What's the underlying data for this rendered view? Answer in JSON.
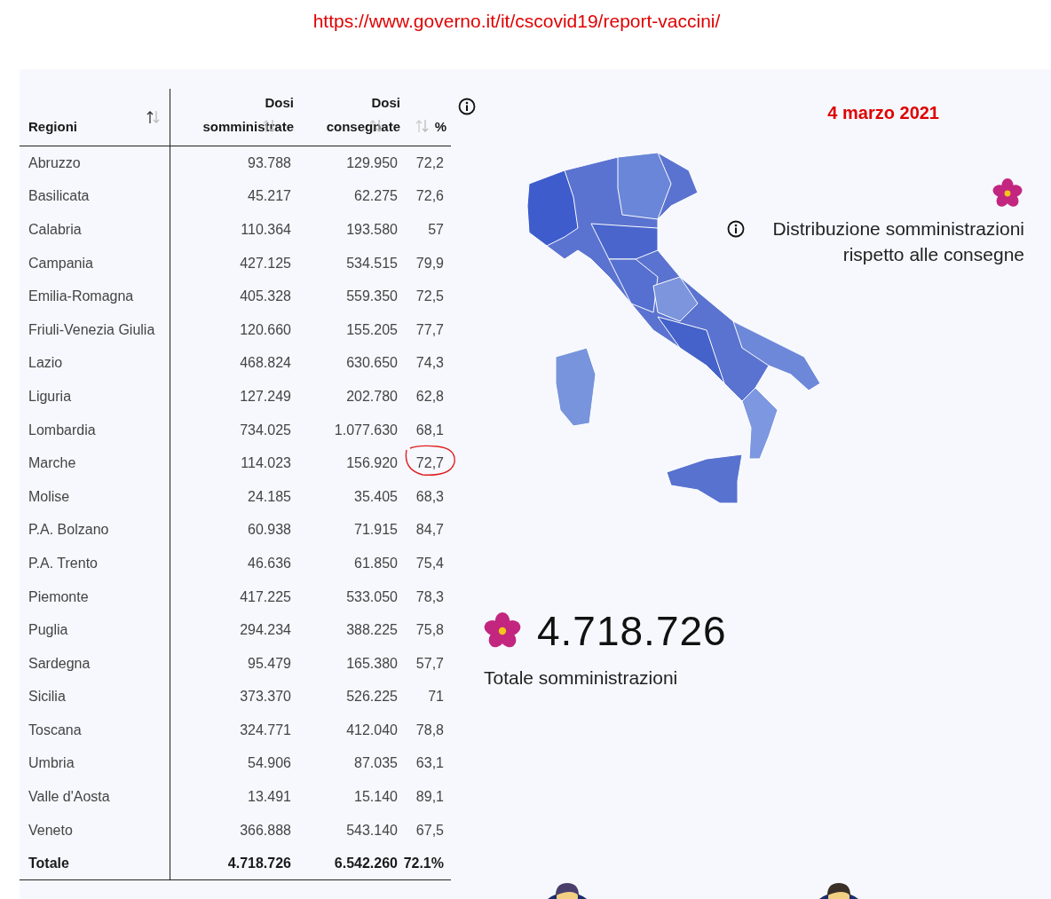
{
  "url": "https://www.governo.it/it/cscovid19/report-vaccini/",
  "table": {
    "columns": [
      {
        "lines": [
          "Regioni"
        ],
        "sorted": true
      },
      {
        "lines": [
          "Dosi",
          "somministrate"
        ],
        "sorted": false
      },
      {
        "lines": [
          "Dosi",
          "consegnate"
        ],
        "sorted": false
      },
      {
        "lines": [
          "%"
        ],
        "sorted": false
      }
    ],
    "rows": [
      {
        "cells": [
          "Abruzzo",
          "93.788",
          "129.950",
          "72,2"
        ],
        "circled": false
      },
      {
        "cells": [
          "Basilicata",
          "45.217",
          "62.275",
          "72,6"
        ],
        "circled": false
      },
      {
        "cells": [
          "Calabria",
          "110.364",
          "193.580",
          "57"
        ],
        "circled": false
      },
      {
        "cells": [
          "Campania",
          "427.125",
          "534.515",
          "79,9"
        ],
        "circled": false
      },
      {
        "cells": [
          "Emilia-Romagna",
          "405.328",
          "559.350",
          "72,5"
        ],
        "circled": false
      },
      {
        "cells": [
          "Friuli-Venezia Giulia",
          "120.660",
          "155.205",
          "77,7"
        ],
        "circled": false
      },
      {
        "cells": [
          "Lazio",
          "468.824",
          "630.650",
          "74,3"
        ],
        "circled": false
      },
      {
        "cells": [
          "Liguria",
          "127.249",
          "202.780",
          "62,8"
        ],
        "circled": false
      },
      {
        "cells": [
          "Lombardia",
          "734.025",
          "1.077.630",
          "68,1"
        ],
        "circled": false
      },
      {
        "cells": [
          "Marche",
          "114.023",
          "156.920",
          "72,7"
        ],
        "circled": true
      },
      {
        "cells": [
          "Molise",
          "24.185",
          "35.405",
          "68,3"
        ],
        "circled": false
      },
      {
        "cells": [
          "P.A. Bolzano",
          "60.938",
          "71.915",
          "84,7"
        ],
        "circled": false
      },
      {
        "cells": [
          "P.A. Trento",
          "46.636",
          "61.850",
          "75,4"
        ],
        "circled": false
      },
      {
        "cells": [
          "Piemonte",
          "417.225",
          "533.050",
          "78,3"
        ],
        "circled": false
      },
      {
        "cells": [
          "Puglia",
          "294.234",
          "388.225",
          "75,8"
        ],
        "circled": false
      },
      {
        "cells": [
          "Sardegna",
          "95.479",
          "165.380",
          "57,7"
        ],
        "circled": false
      },
      {
        "cells": [
          "Sicilia",
          "373.370",
          "526.225",
          "71"
        ],
        "circled": false
      },
      {
        "cells": [
          "Toscana",
          "324.771",
          "412.040",
          "78,8"
        ],
        "circled": false
      },
      {
        "cells": [
          "Umbria",
          "54.906",
          "87.035",
          "63,1"
        ],
        "circled": false
      },
      {
        "cells": [
          "Valle d'Aosta",
          "13.491",
          "15.140",
          "89,1"
        ],
        "circled": false
      },
      {
        "cells": [
          "Veneto",
          "366.888",
          "543.140",
          "67,5"
        ],
        "circled": false
      }
    ],
    "total": [
      "Totale",
      "4.718.726",
      "6.542.260",
      "72.1%"
    ]
  },
  "date": "4 marzo 2021",
  "legend": "Distribuzione somministrazioni rispetto alle consegne",
  "summary": {
    "value": "4.718.726",
    "label": "Totale somministrazioni"
  }
}
